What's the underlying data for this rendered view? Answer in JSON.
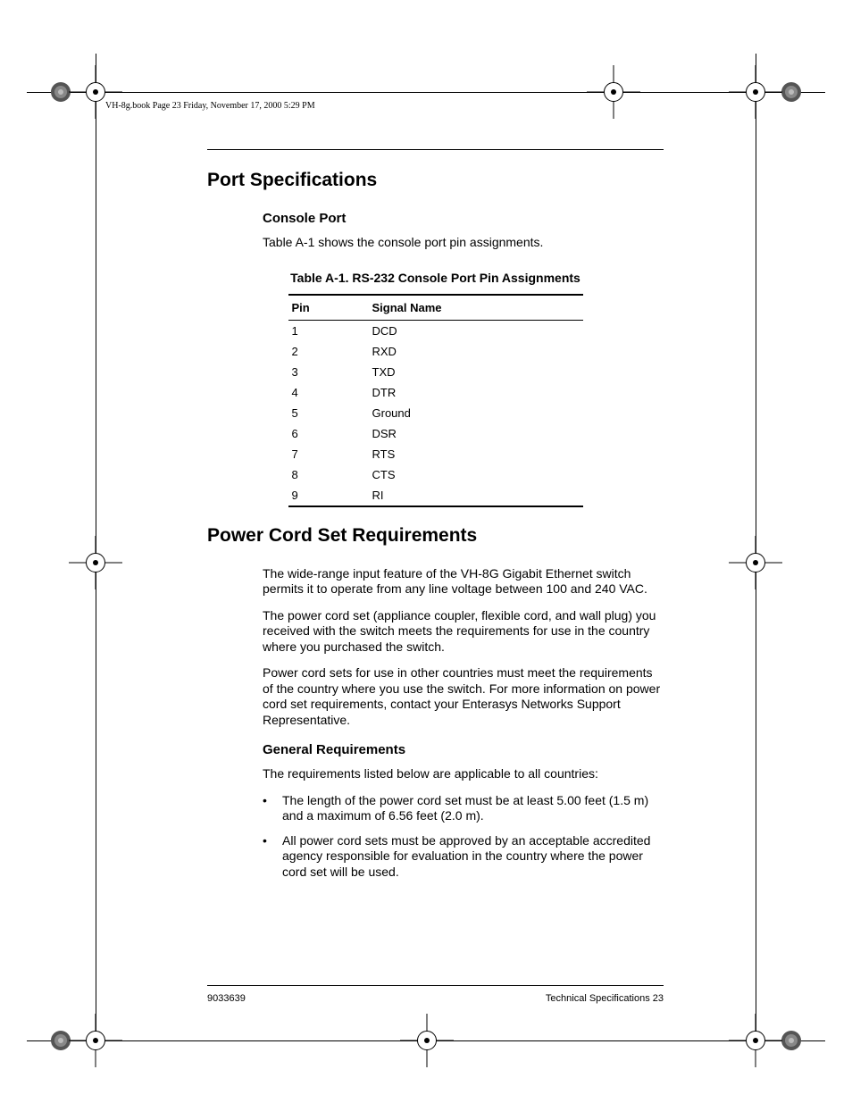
{
  "runningHead": "VH-8g.book  Page 23  Friday, November 17, 2000  5:29 PM",
  "section1": {
    "title": "Port Specifications",
    "sub1": {
      "title": "Console Port",
      "intro": "Table A-1 shows the console port pin assignments.",
      "tableCaption": "Table A-1.  RS-232 Console Port Pin Assignments",
      "tableHead": {
        "c1": "Pin",
        "c2": "Signal Name"
      },
      "rows": [
        {
          "c1": "1",
          "c2": "DCD"
        },
        {
          "c1": "2",
          "c2": "RXD"
        },
        {
          "c1": "3",
          "c2": "TXD"
        },
        {
          "c1": "4",
          "c2": "DTR"
        },
        {
          "c1": "5",
          "c2": "Ground"
        },
        {
          "c1": "6",
          "c2": "DSR"
        },
        {
          "c1": "7",
          "c2": "RTS"
        },
        {
          "c1": "8",
          "c2": "CTS"
        },
        {
          "c1": "9",
          "c2": "RI"
        }
      ]
    }
  },
  "section2": {
    "title": "Power Cord Set Requirements",
    "p1": "The wide-range input feature of the VH-8G Gigabit Ethernet switch permits it to operate from any line voltage between 100 and 240 VAC.",
    "p2": "The power cord set (appliance coupler, flexible cord, and wall plug) you received with the switch meets the requirements for use in the country where you purchased the switch.",
    "p3": "Power cord sets for use in other countries must meet the requirements of the country where you use the switch. For more information on power cord set requirements, contact your Enterasys Networks Support Representative.",
    "sub1": {
      "title": "General Requirements",
      "intro": "The requirements listed below are applicable to all countries:",
      "bullets": [
        "The length of the power cord set must be at least 5.00 feet (1.5 m) and a maximum of 6.56 feet (2.0 m).",
        "All power cord sets must be approved by an acceptable accredited agency responsible for evaluation in the country where the power cord set will be used."
      ]
    }
  },
  "footer": {
    "left": "9033639",
    "right": "Technical Specifications  23"
  }
}
